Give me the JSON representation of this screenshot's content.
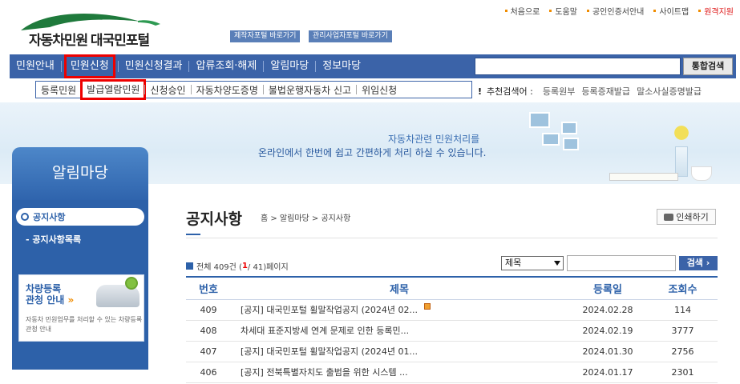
{
  "util_links": [
    {
      "label": "처음으로",
      "highlight": false
    },
    {
      "label": "도움말",
      "highlight": false
    },
    {
      "label": "공인인증서안내",
      "highlight": false
    },
    {
      "label": "사이트맵",
      "highlight": false
    },
    {
      "label": "원격지원",
      "highlight": true
    }
  ],
  "logo": {
    "text": "자동차민원 대국민포털"
  },
  "portal_buttons": {
    "maker": "제작자포털 바로가기",
    "manager": "관리사업자포털 바로가기"
  },
  "main_nav": {
    "items": [
      "민원안내",
      "민원신청",
      "민원신청결과",
      "압류조회·해제",
      "알림마당",
      "정보마당"
    ],
    "active_index": 1,
    "search_button": "통합검색",
    "search_value": ""
  },
  "sub_nav": {
    "items": [
      "등록민원",
      "발급열람민원",
      "신청승인",
      "자동차양도증명",
      "불법운행자동차 신고",
      "위임신청"
    ],
    "active_index": 1
  },
  "recommended": {
    "bang": "!",
    "label": "추천검색어 :",
    "keywords": [
      "등록원부",
      "등록증재발급",
      "말소사실증명발급"
    ]
  },
  "banner": {
    "line1": "자동차관련 민원처리를",
    "line2": "온라인에서 한번에 쉽고 간편하게 처리 하실 수 있습니다."
  },
  "sidebar": {
    "title": "알림마당",
    "active": "공지사항",
    "sub": "- 공지사항목록",
    "card": {
      "title1": "차량등록",
      "title2": "관청 안내",
      "arrow": "»",
      "desc": "자동차 민원업무를 처리할 수 있는 차량등록관청 안내"
    }
  },
  "page": {
    "title": "공지사항",
    "breadcrumb": "홈 > 알림마당 > 공지사항",
    "print_label": "인쇄하기",
    "total_prefix": "전체 409건 (",
    "current_page": "1",
    "total_suffix": " / 41)페이지"
  },
  "search": {
    "select_value": "제목",
    "input_value": "",
    "button": "검색 ›"
  },
  "table": {
    "headers": {
      "no": "번호",
      "title": "제목",
      "date": "등록일",
      "views": "조회수"
    },
    "rows": [
      {
        "no": "409",
        "title": "[공지] 대국민포털 휠말작업공지 (2024년 02...",
        "date": "2024.02.28",
        "views": "114",
        "new": true
      },
      {
        "no": "408",
        "title": "차세대 표준지방세 연계 문제로 인한 등록민...",
        "date": "2024.02.19",
        "views": "3777",
        "new": false
      },
      {
        "no": "407",
        "title": "[공지] 대국민포털 휠말작업공지 (2024년 01...",
        "date": "2024.01.30",
        "views": "2756",
        "new": false
      },
      {
        "no": "406",
        "title": "[공지] 전북특별자치도 출범을 위한 시스템 ...",
        "date": "2024.01.17",
        "views": "2301",
        "new": false
      }
    ]
  }
}
